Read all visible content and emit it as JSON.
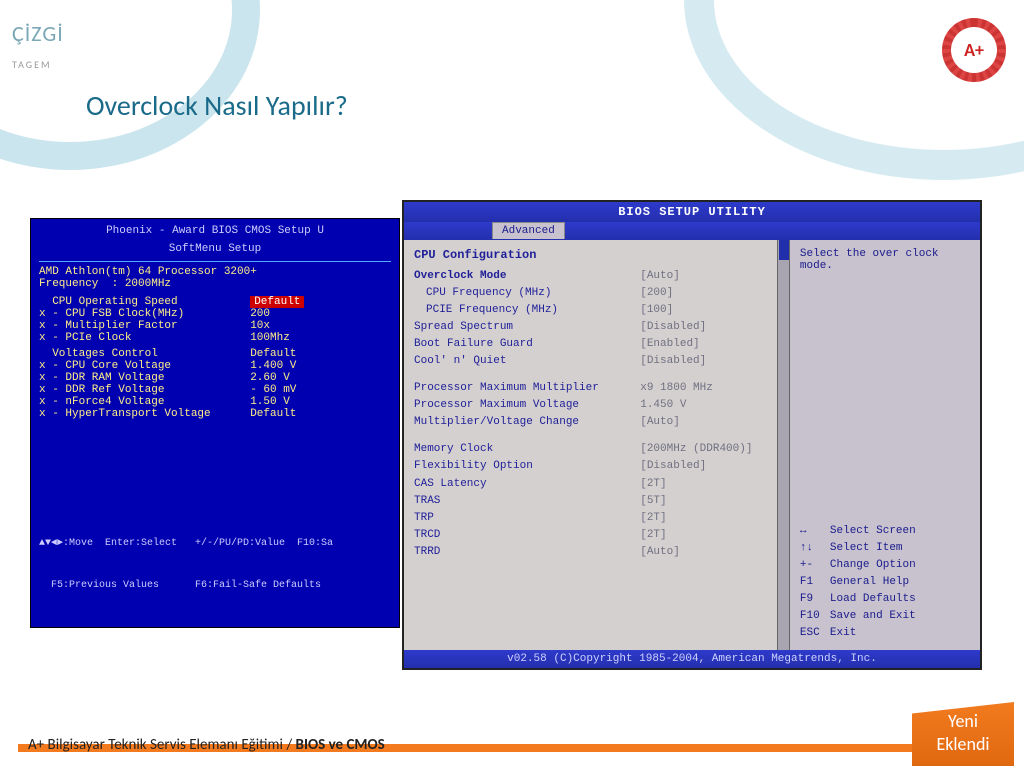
{
  "logo": {
    "main": "ÇİZGİ",
    "sub": "TAGEM"
  },
  "aplus": "A+",
  "slide_title": "Overclock Nasıl Yapılır?",
  "left": {
    "header1": "Phoenix - Award BIOS CMOS Setup U",
    "header2": "SoftMenu Setup",
    "cpu_line": "AMD Athlon(tm) 64 Processor 3200+",
    "freq_line": "Frequency  : 2000MHz",
    "rows1": [
      {
        "k": "  CPU Operating Speed",
        "v": "Default",
        "hl": true
      },
      {
        "k": "x - CPU FSB Clock(MHz)",
        "v": "200"
      },
      {
        "k": "x - Multiplier Factor",
        "v": "10x"
      },
      {
        "k": "x - PCIe Clock",
        "v": "100Mhz"
      }
    ],
    "rows2": [
      {
        "k": "  Voltages Control",
        "v": "Default"
      },
      {
        "k": "x - CPU Core Voltage",
        "v": "1.400 V"
      },
      {
        "k": "x - DDR RAM Voltage",
        "v": "2.60 V"
      },
      {
        "k": "x - DDR Ref Voltage",
        "v": "- 60 mV"
      },
      {
        "k": "x - nForce4 Voltage",
        "v": "1.50 V"
      },
      {
        "k": "x - HyperTransport Voltage",
        "v": "Default"
      }
    ],
    "footer1": "▲▼◄►:Move  Enter:Select   +/-/PU/PD:Value  F10:Sa",
    "footer2": "  F5:Previous Values      F6:Fail-Safe Defaults"
  },
  "right": {
    "title": "BIOS SETUP UTILITY",
    "tab": "Advanced",
    "section": "CPU Configuration",
    "lines": [
      {
        "k": "Overclock Mode",
        "v": "[Auto]",
        "bold": true
      },
      {
        "k": "CPU Frequency (MHz)",
        "v": "[200]",
        "sub": true
      },
      {
        "k": "PCIE Frequency (MHz)",
        "v": "[100]",
        "sub": true
      },
      {
        "k": "Spread Spectrum",
        "v": "[Disabled]"
      },
      {
        "k": "Boot Failure Guard",
        "v": "[Enabled]"
      },
      {
        "k": "Cool' n' Quiet",
        "v": "[Disabled]"
      },
      {
        "spacer": true
      },
      {
        "k": "Processor Maximum Multiplier",
        "v": "x9  1800 MHz"
      },
      {
        "k": "Processor Maximum Voltage",
        "v": "1.450 V"
      },
      {
        "k": "Multiplier/Voltage Change",
        "v": "[Auto]"
      },
      {
        "spacer": true
      },
      {
        "k": "Memory Clock",
        "v": "[200MHz (DDR400)]"
      },
      {
        "k": "Flexibility Option",
        "v": "[Disabled]"
      },
      {
        "k": "CAS Latency",
        "v": "[2T]"
      },
      {
        "k": "TRAS",
        "v": "[5T]"
      },
      {
        "k": "TRP",
        "v": "[2T]"
      },
      {
        "k": "TRCD",
        "v": "[2T]"
      },
      {
        "k": "TRRD",
        "v": "[Auto]"
      }
    ],
    "help": "Select the over clock mode.",
    "keys": [
      {
        "k": "↔",
        "v": "Select Screen"
      },
      {
        "k": "↑↓",
        "v": "Select Item"
      },
      {
        "k": "+-",
        "v": "Change Option"
      },
      {
        "k": "F1",
        "v": "General Help"
      },
      {
        "k": "F9",
        "v": "Load Defaults"
      },
      {
        "k": "F10",
        "v": "Save and Exit"
      },
      {
        "k": "ESC",
        "v": "Exit"
      }
    ],
    "copyright": "v02.58 (C)Copyright 1985-2004, American Megatrends, Inc."
  },
  "bottom": {
    "text_prefix": "A+ Bilgisayar Teknik Servis Elemanı Eğitimi / ",
    "text_bold": "BIOS ve CMOS",
    "yeni1": "Yeni",
    "yeni2": "Eklendi"
  }
}
